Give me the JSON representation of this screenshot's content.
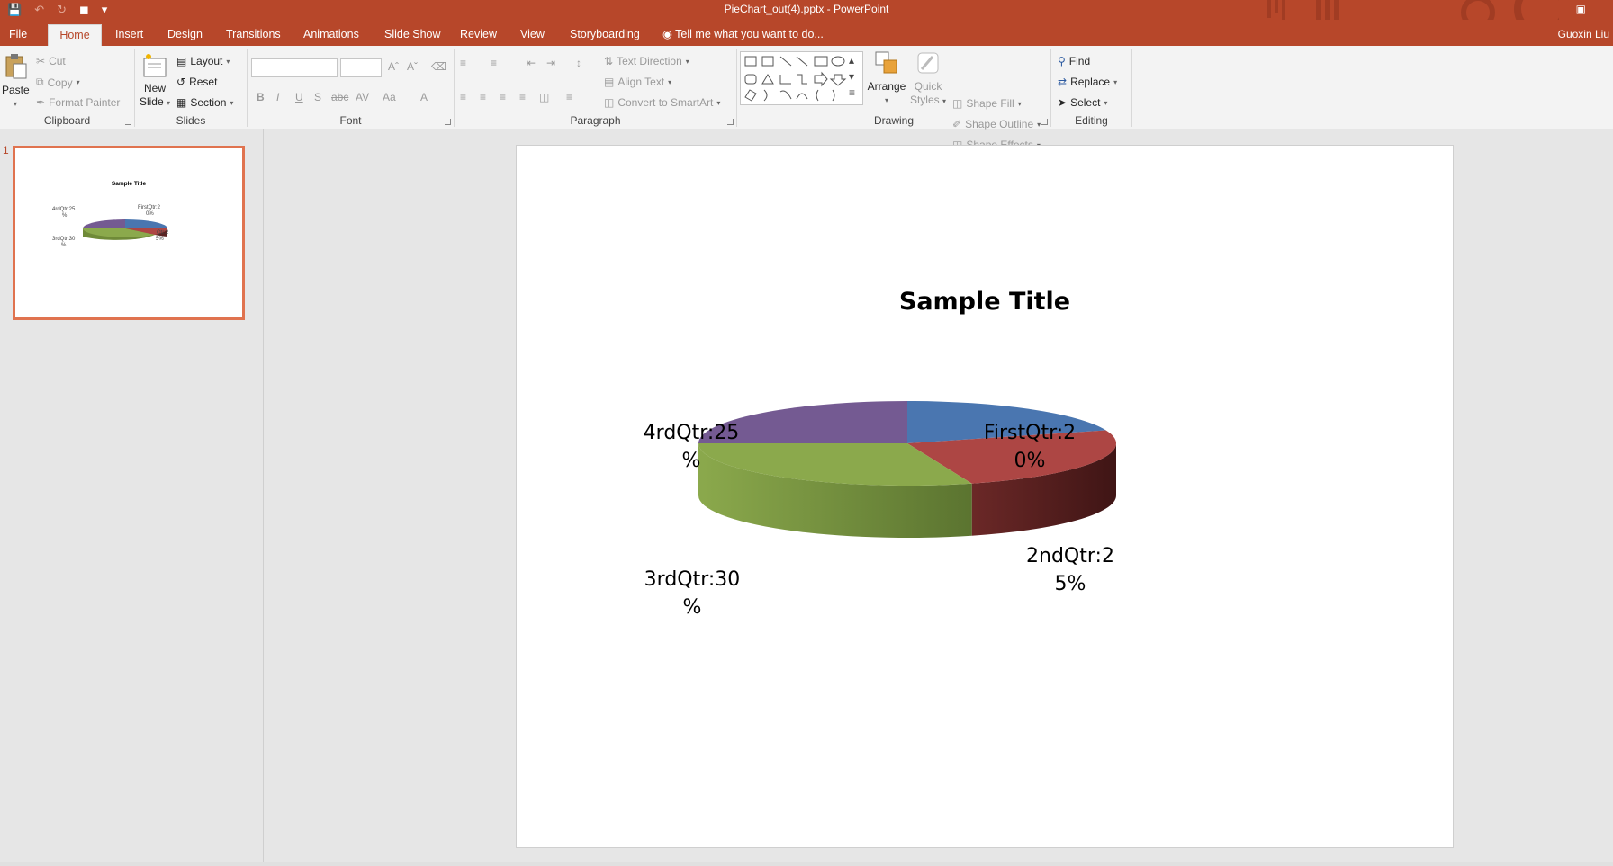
{
  "window": {
    "title": "PieChart_out(4).pptx - PowerPoint",
    "user": "Guoxin Liu"
  },
  "tabs": [
    {
      "label": "File"
    },
    {
      "label": "Home"
    },
    {
      "label": "Insert"
    },
    {
      "label": "Design"
    },
    {
      "label": "Transitions"
    },
    {
      "label": "Animations"
    },
    {
      "label": "Slide Show"
    },
    {
      "label": "Review"
    },
    {
      "label": "View"
    },
    {
      "label": "Storyboarding"
    }
  ],
  "tell_me": "Tell me what you want to do...",
  "ribbon": {
    "clipboard": {
      "paste": "Paste",
      "cut": "Cut",
      "copy": "Copy",
      "format_painter": "Format Painter",
      "label": "Clipboard"
    },
    "slides": {
      "new_slide_1": "New",
      "new_slide_2": "Slide",
      "layout": "Layout",
      "reset": "Reset",
      "section": "Section",
      "label": "Slides"
    },
    "font": {
      "label": "Font"
    },
    "paragraph": {
      "text_direction": "Text Direction",
      "align_text": "Align Text",
      "convert_smartart": "Convert to SmartArt",
      "label": "Paragraph"
    },
    "drawing": {
      "arrange": "Arrange",
      "quick_1": "Quick",
      "quick_2": "Styles",
      "shape_fill": "Shape Fill",
      "shape_outline": "Shape Outline",
      "shape_effects": "Shape Effects",
      "label": "Drawing"
    },
    "editing": {
      "find": "Find",
      "replace": "Replace",
      "select": "Select",
      "label": "Editing"
    }
  },
  "slide_panel": {
    "number": "1"
  },
  "slide": {
    "title": "Sample Title"
  },
  "chart_data": {
    "type": "pie",
    "title": "Sample Title",
    "categories": [
      "FirstQtr",
      "2ndQtr",
      "3rdQtr",
      "4rdQtr"
    ],
    "values": [
      20,
      25,
      30,
      25
    ],
    "colors": [
      "#4a76b0",
      "#ad4644",
      "#8ba94c",
      "#745a92"
    ],
    "labels": {
      "first": [
        "FirstQtr:2",
        "0%"
      ],
      "second": [
        "2ndQtr:2",
        "5%"
      ],
      "third": [
        "3rdQtr:30",
        "%"
      ],
      "fourth": [
        "4rdQtr:25",
        "%"
      ]
    },
    "thumb_labels": {
      "title": "Sample Title",
      "first": [
        "FirstQtr:2",
        "0%"
      ],
      "second": [
        "Qtr:2",
        "5%"
      ],
      "third": [
        "3rdQtr:30",
        "%"
      ],
      "fourth": [
        "4rdQtr:25",
        "%"
      ]
    }
  }
}
